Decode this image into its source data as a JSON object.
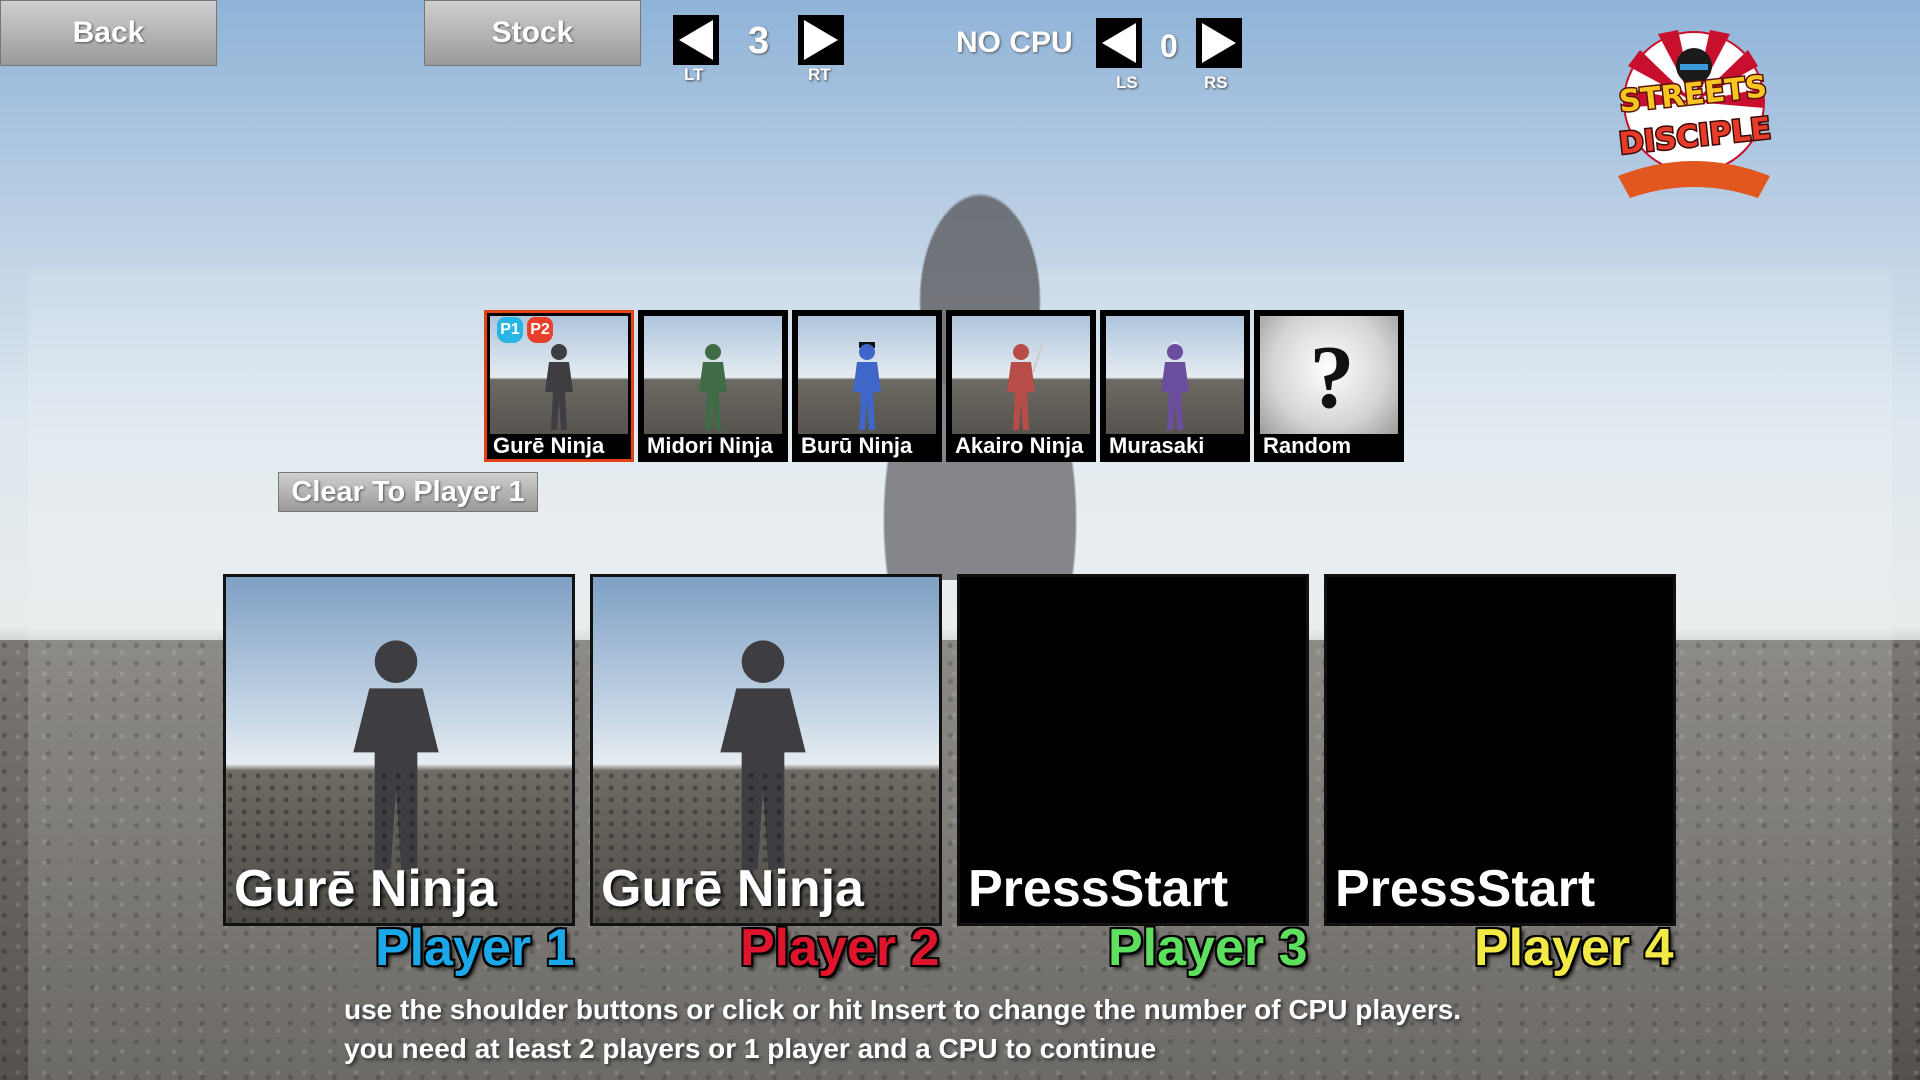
{
  "top_bar": {
    "back_label": "Back",
    "stock_label": "Stock",
    "stock_value": "3",
    "stock_left_hint": "LT",
    "stock_right_hint": "RT",
    "cpu_label": "NO CPU",
    "cpu_value": "0",
    "cpu_left_hint": "LS",
    "cpu_right_hint": "RS"
  },
  "logo": {
    "line1": "STREETS",
    "line2": "DISCIPLE"
  },
  "characters": [
    {
      "name": "Gurē Ninja",
      "color": "#3d3d42",
      "selected": true,
      "badges": [
        "P1",
        "P2"
      ]
    },
    {
      "name": "Midori Ninja",
      "color": "#3f6b45"
    },
    {
      "name": "Burū Ninja",
      "color": "#3f66c9"
    },
    {
      "name": "Akairo Ninja",
      "color": "#b84c48"
    },
    {
      "name": "Murasaki",
      "color": "#6a4f9e"
    },
    {
      "name": "Random",
      "symbol": "?"
    }
  ],
  "clear_button": "Clear To Player 1",
  "slots": [
    {
      "label": "Gurē Ninja",
      "player": "Player 1",
      "player_color": "#1aa8e8",
      "filled": true
    },
    {
      "label": "Gurē Ninja",
      "player": "Player 2",
      "player_color": "#e0142c",
      "filled": true
    },
    {
      "label": "PressStart",
      "player": "Player 3",
      "player_color": "#5ee05e",
      "filled": false
    },
    {
      "label": "PressStart",
      "player": "Player 4",
      "player_color": "#f2ea46",
      "filled": false
    }
  ],
  "help": {
    "line1": "use the shoulder buttons or click or hit Insert to change the number of CPU players.",
    "line2": "you need at least 2 players or 1 player and a CPU to continue"
  },
  "badge_colors": {
    "P1": "#27b6e3",
    "P2": "#e8402a"
  },
  "selection_color": "#e34313"
}
